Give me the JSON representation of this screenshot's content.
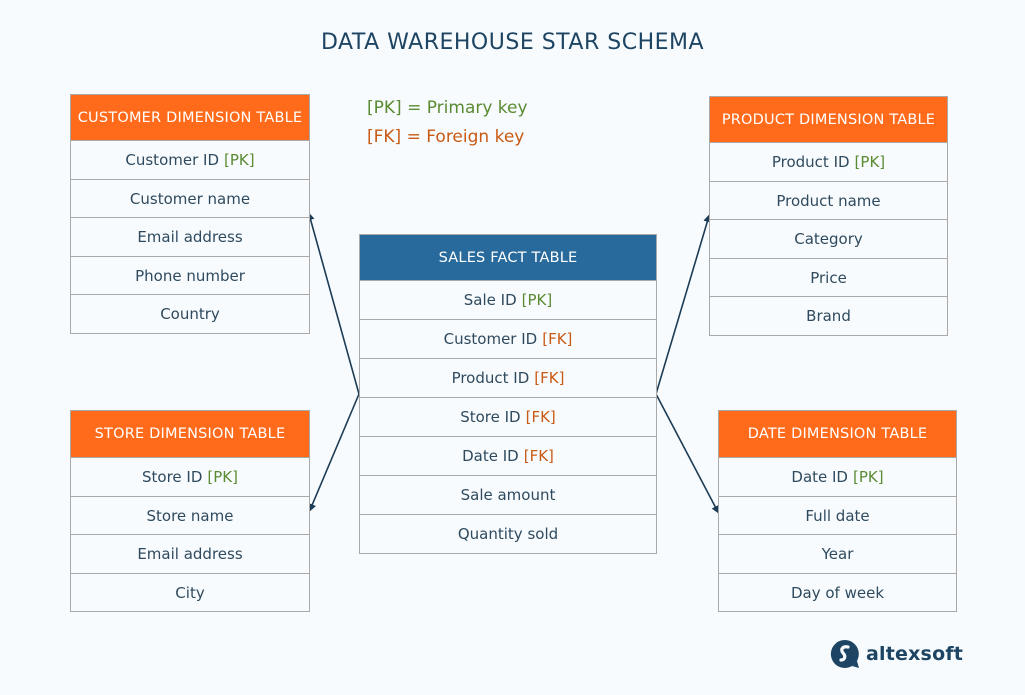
{
  "title": "DATA WAREHOUSE STAR SCHEMA",
  "colors": {
    "dimension_header": "#ff6b1a",
    "fact_header": "#276a9b",
    "primary_key": "#5a8a32",
    "foreign_key": "#c95a14",
    "text": "#2f4a5e",
    "title": "#1d4563"
  },
  "legend": {
    "pk": "[PK] = Primary key",
    "fk": "[FK] = Foreign key"
  },
  "tables": {
    "customer": {
      "header": "CUSTOMER DIMENSION TABLE",
      "rows": [
        {
          "label": "Customer ID",
          "tag": "[PK]"
        },
        {
          "label": "Customer name",
          "tag": ""
        },
        {
          "label": "Email address",
          "tag": ""
        },
        {
          "label": "Phone number",
          "tag": ""
        },
        {
          "label": "Country",
          "tag": ""
        }
      ]
    },
    "store": {
      "header": "STORE DIMENSION TABLE",
      "rows": [
        {
          "label": "Store ID",
          "tag": "[PK]"
        },
        {
          "label": "Store name",
          "tag": ""
        },
        {
          "label": "Email address",
          "tag": ""
        },
        {
          "label": "City",
          "tag": ""
        }
      ]
    },
    "fact": {
      "header": "SALES FACT TABLE",
      "rows": [
        {
          "label": "Sale ID",
          "tag": "[PK]"
        },
        {
          "label": "Customer ID",
          "tag": "[FK]"
        },
        {
          "label": "Product ID",
          "tag": "[FK]"
        },
        {
          "label": "Store ID",
          "tag": "[FK]"
        },
        {
          "label": "Date ID",
          "tag": "[FK]"
        },
        {
          "label": "Sale amount",
          "tag": ""
        },
        {
          "label": "Quantity sold",
          "tag": ""
        }
      ]
    },
    "product": {
      "header": "PRODUCT DIMENSION TABLE",
      "rows": [
        {
          "label": "Product ID",
          "tag": "[PK]"
        },
        {
          "label": "Product name",
          "tag": ""
        },
        {
          "label": "Category",
          "tag": ""
        },
        {
          "label": "Price",
          "tag": ""
        },
        {
          "label": "Brand",
          "tag": ""
        }
      ]
    },
    "date": {
      "header": "DATE DIMENSION TABLE",
      "rows": [
        {
          "label": "Date ID",
          "tag": "[PK]"
        },
        {
          "label": "Full date",
          "tag": ""
        },
        {
          "label": "Year",
          "tag": ""
        },
        {
          "label": "Day of week",
          "tag": ""
        }
      ]
    }
  },
  "connections": [
    {
      "from": "fact",
      "to": "customer"
    },
    {
      "from": "fact",
      "to": "store"
    },
    {
      "from": "fact",
      "to": "product"
    },
    {
      "from": "fact",
      "to": "date"
    }
  ],
  "logo": {
    "icon": "altexsoft-logo-icon",
    "text": "altexsoft"
  }
}
